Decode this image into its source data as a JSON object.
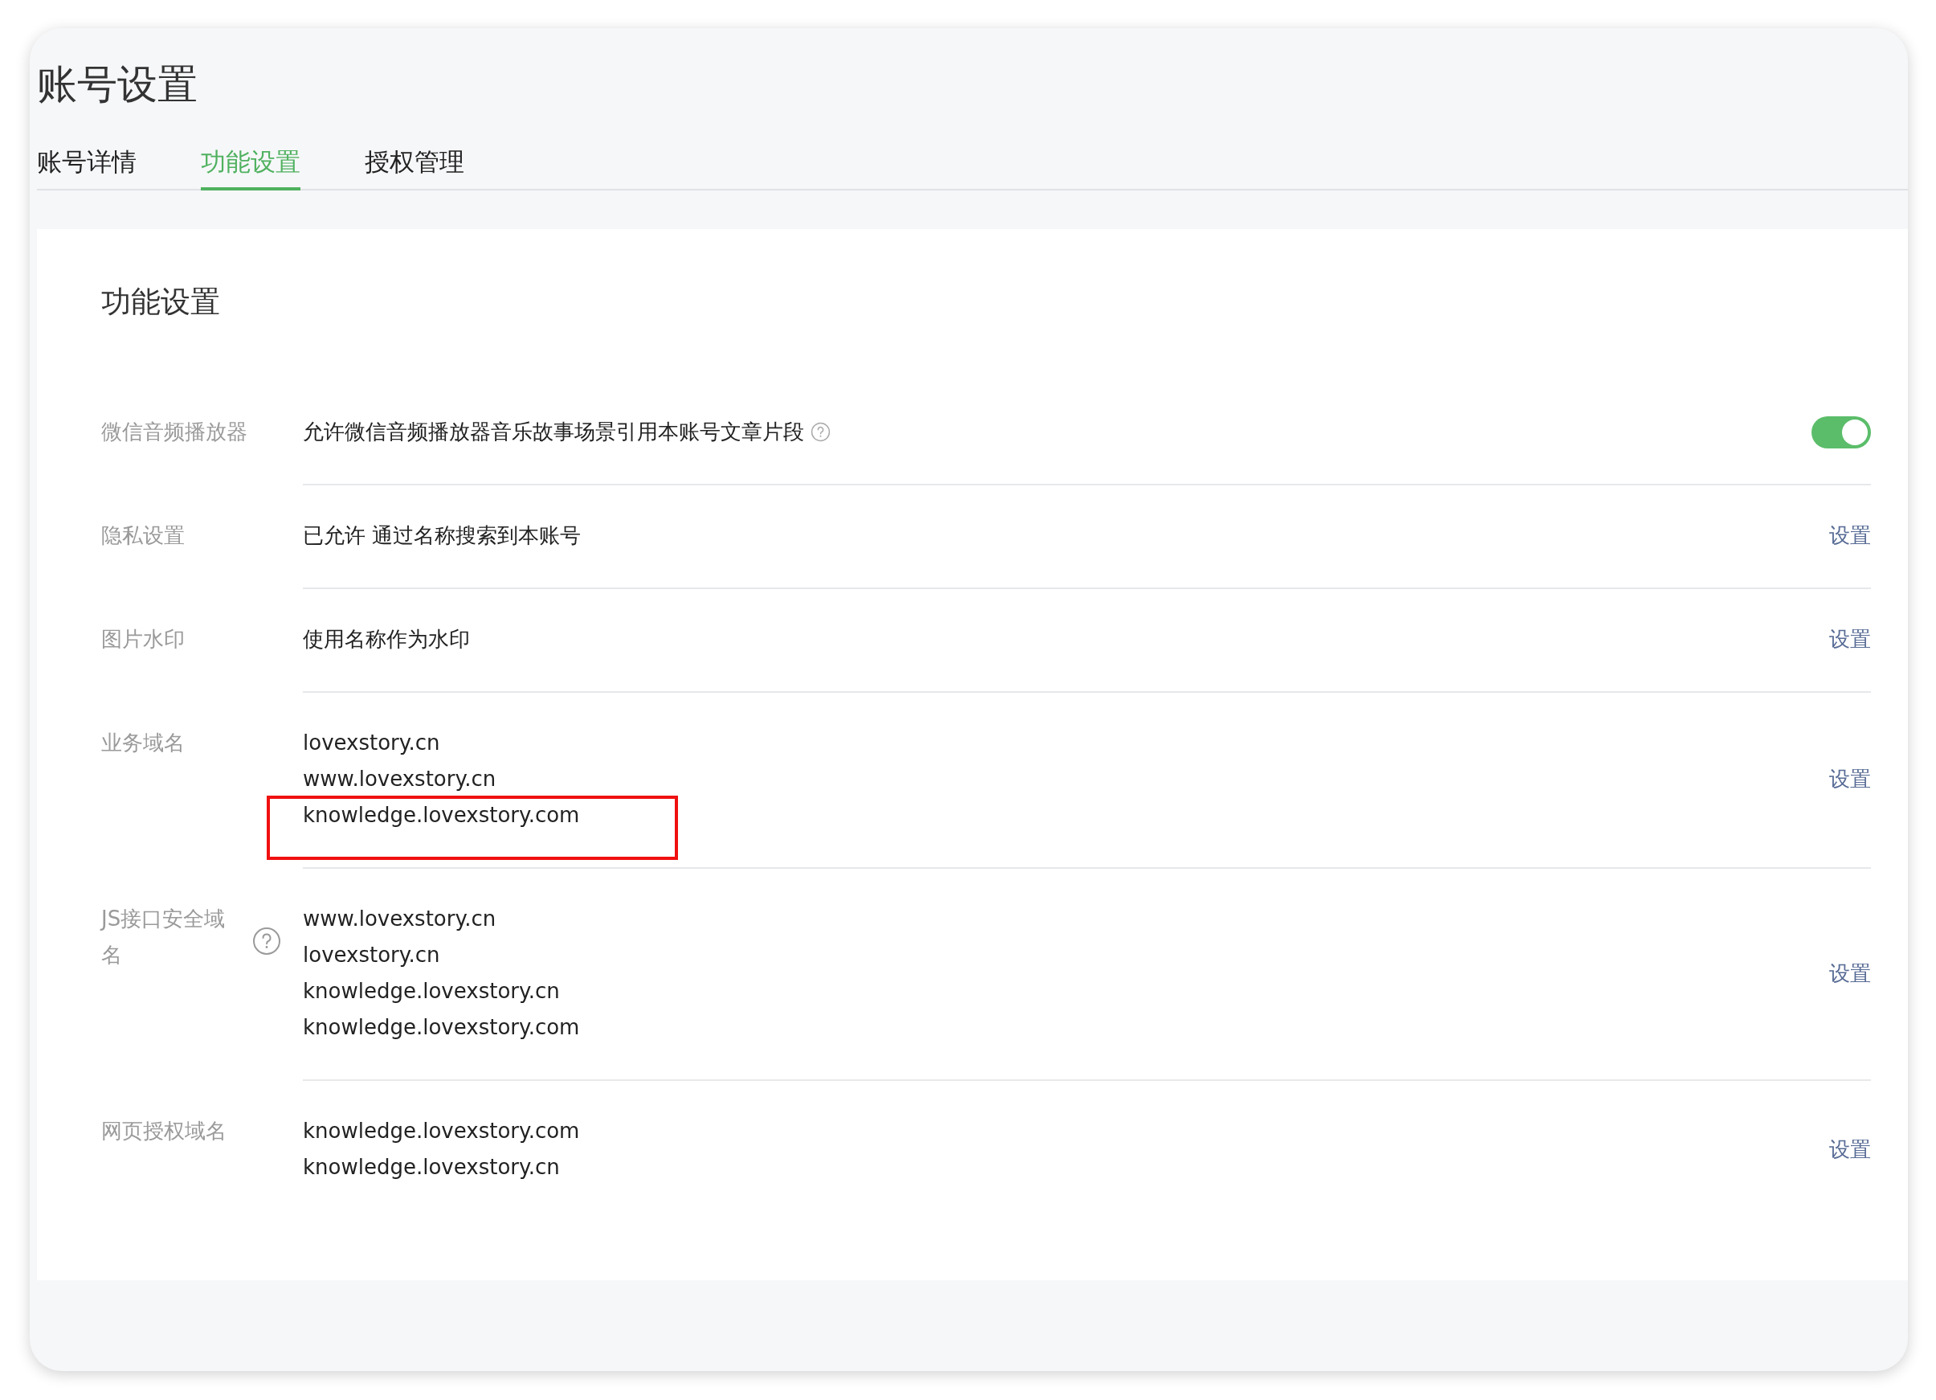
{
  "page_title": "账号设置",
  "tabs": [
    {
      "label": "账号详情",
      "selected": false
    },
    {
      "label": "功能设置",
      "selected": true
    },
    {
      "label": "授权管理",
      "selected": false
    }
  ],
  "section_title": "功能设置",
  "settings": [
    {
      "kind": "toggle",
      "label": "微信音频播放器",
      "label_help": false,
      "value_help": true,
      "lines": [
        {
          "text": "允许微信音频播放器音乐故事场景引用本账号文章片段",
          "highlighted": false
        }
      ],
      "on": true
    },
    {
      "kind": "link",
      "label": "隐私设置",
      "label_help": false,
      "value_help": false,
      "lines": [
        {
          "text": "已允许 通过名称搜索到本账号",
          "highlighted": false
        }
      ],
      "action": "设置"
    },
    {
      "kind": "link",
      "label": "图片水印",
      "label_help": false,
      "value_help": false,
      "lines": [
        {
          "text": "使用名称作为水印",
          "highlighted": false
        }
      ],
      "action": "设置"
    },
    {
      "kind": "link",
      "label": "业务域名",
      "label_help": false,
      "value_help": false,
      "lines": [
        {
          "text": "lovexstory.cn",
          "highlighted": false
        },
        {
          "text": "www.lovexstory.cn",
          "highlighted": false
        },
        {
          "text": "knowledge.lovexstory.com",
          "highlighted": true
        }
      ],
      "action": "设置"
    },
    {
      "kind": "link",
      "label": "JS接口安全域名",
      "label_help": true,
      "value_help": false,
      "lines": [
        {
          "text": "www.lovexstory.cn",
          "highlighted": false
        },
        {
          "text": "lovexstory.cn",
          "highlighted": false
        },
        {
          "text": "knowledge.lovexstory.cn",
          "highlighted": false
        },
        {
          "text": "knowledge.lovexstory.com",
          "highlighted": false
        }
      ],
      "action": "设置"
    },
    {
      "kind": "link",
      "label": "网页授权域名",
      "label_help": false,
      "value_help": false,
      "lines": [
        {
          "text": "knowledge.lovexstory.com",
          "highlighted": false
        },
        {
          "text": "knowledge.lovexstory.cn",
          "highlighted": false
        }
      ],
      "action": "设置"
    }
  ]
}
